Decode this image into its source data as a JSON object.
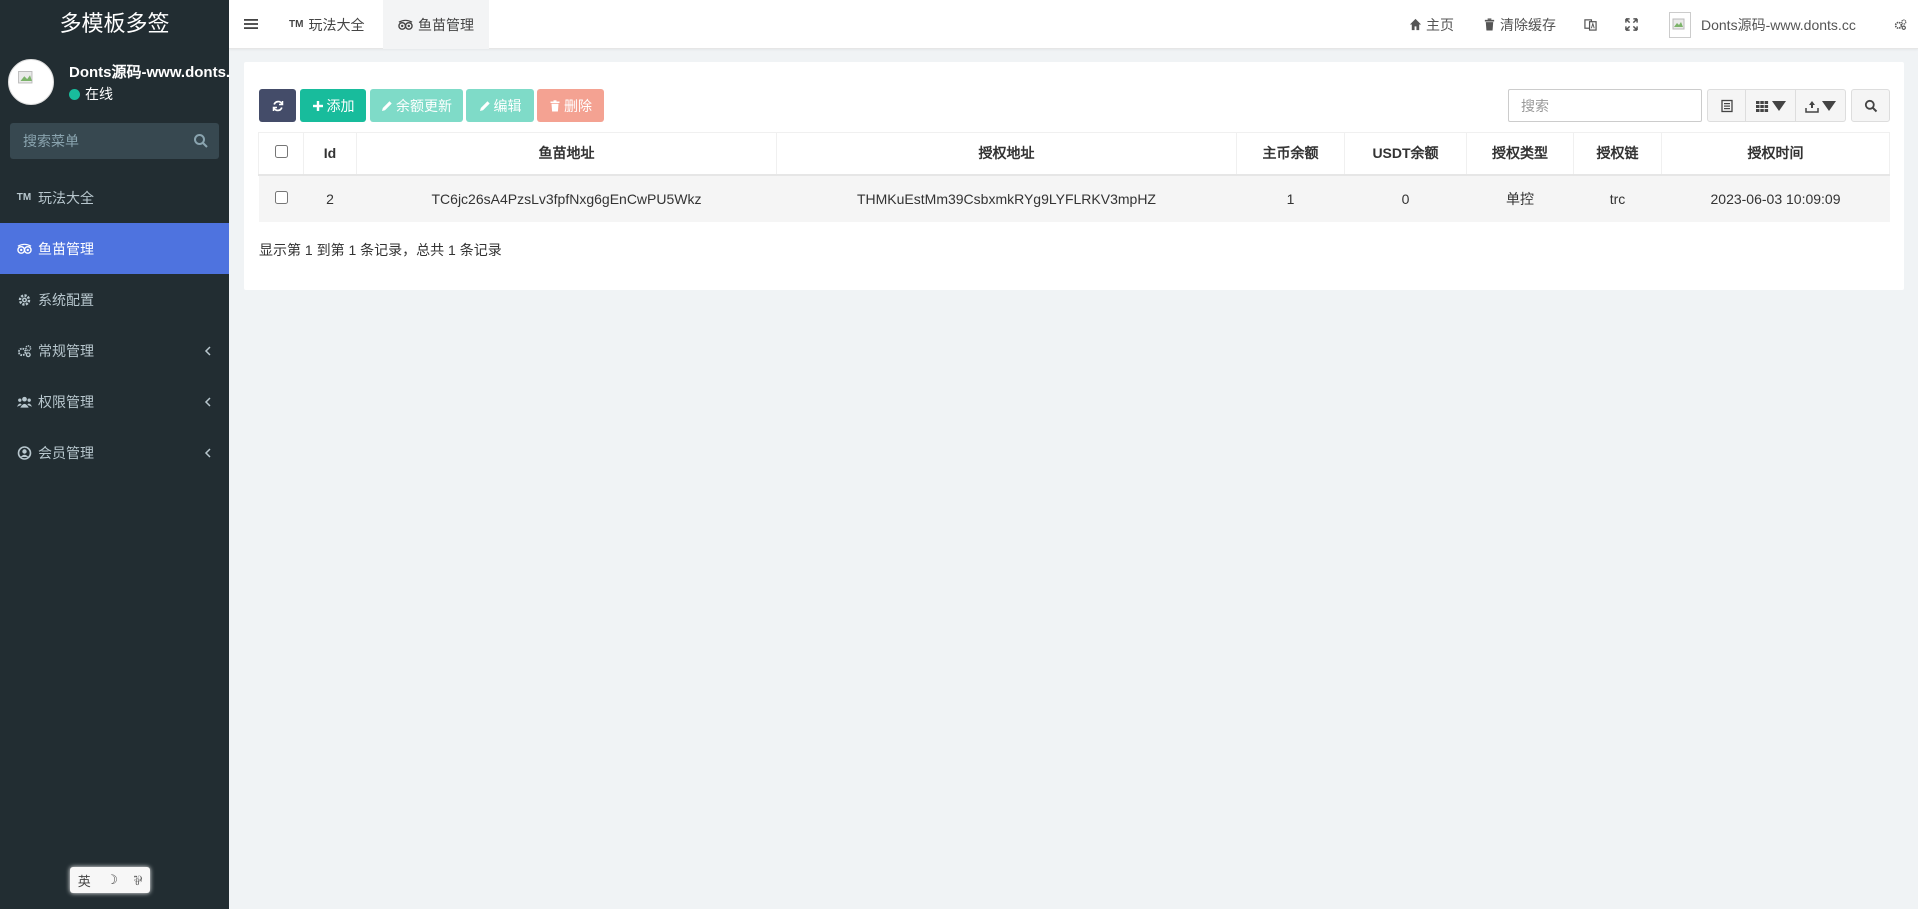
{
  "sidebar": {
    "logo": "多模板多签",
    "user": {
      "name": "Donts源码-www.donts.cc",
      "status": "在线"
    },
    "search": {
      "placeholder": "搜索菜单"
    },
    "items": [
      {
        "label": "玩法大全",
        "icon": "tm-icon",
        "active": false
      },
      {
        "label": "鱼苗管理",
        "icon": "eye-icon",
        "active": true
      },
      {
        "label": "系统配置",
        "icon": "gear-icon",
        "active": false
      },
      {
        "label": "常规管理",
        "icon": "cogs-icon",
        "active": false
      },
      {
        "label": "权限管理",
        "icon": "users-icon",
        "active": false
      },
      {
        "label": "会员管理",
        "icon": "user-circle-icon",
        "active": false
      }
    ],
    "lang_widget": [
      "英",
      "☽",
      "⅌"
    ]
  },
  "topbar": {
    "tabs": [
      {
        "label": "玩法大全",
        "icon_text": "TM"
      },
      {
        "label": "鱼苗管理",
        "icon_text": ""
      }
    ],
    "home_label": "主页",
    "clear_cache_label": "清除缓存",
    "user_name": "Donts源码-www.donts.cc"
  },
  "toolbar": {
    "add_label": "添加",
    "balance_update_label": "余额更新",
    "edit_label": "编辑",
    "delete_label": "删除",
    "search_placeholder": "搜索"
  },
  "table": {
    "columns": [
      "Id",
      "鱼苗地址",
      "授权地址",
      "主币余额",
      "USDT余额",
      "授权类型",
      "授权链",
      "授权时间"
    ],
    "rows": [
      [
        "2",
        "TC6jc26sA4PzsLv3fpfNxg6gEnCwPU5Wkz",
        "THMKuEstMm39CsbxmkRYg9LYFLRKV3mpHZ",
        "1",
        "0",
        "单控",
        "trc",
        "2023-06-03 10:09:09"
      ]
    ]
  },
  "pagination": {
    "info": "显示第 1 到第 1 条记录，总共 1 条记录"
  },
  "colors": {
    "sidebar_bg": "#222d32",
    "active_menu": "#4e73df",
    "success": "#18bc9c",
    "danger": "#f4a292",
    "dark_button": "#444c69"
  }
}
